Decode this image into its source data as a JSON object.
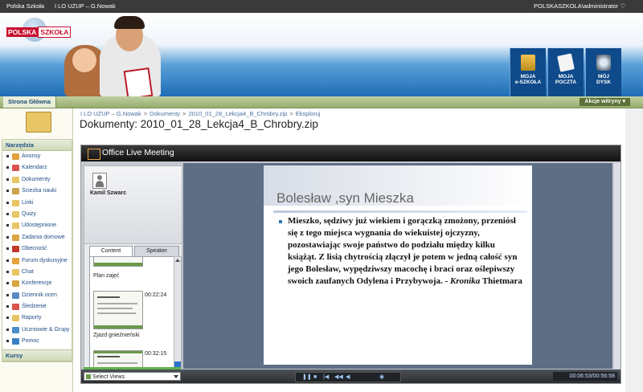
{
  "topbar": {
    "site": "Polska Szkoła",
    "user_path": "I LO UZUP – G.Nowak",
    "login": "POLSKASZKOLA\\administrator ♡"
  },
  "header": {
    "logo_part1": "POLSKA",
    "logo_part2": "SZKOŁA",
    "buttons": [
      {
        "line1": "MOJA",
        "line2": "e-SZKOŁA",
        "icon": "book-icon"
      },
      {
        "line1": "MOJA",
        "line2": "POCZTA",
        "icon": "mail-icon"
      },
      {
        "line1": "MÓJ",
        "line2": "DYSK",
        "icon": "disk-icon"
      }
    ]
  },
  "nav": {
    "home_tab": "Strona Główna",
    "actions": "Akcje witryny ▾"
  },
  "sidebar": {
    "tools_header": "Narzędzia",
    "items": [
      "Anonsy",
      "Kalendarz",
      "Dokumenty",
      "Ścieżka nauki",
      "Linki",
      "Quizy",
      "Udostępnione",
      "Zadania domowe",
      "Obecność",
      "Forum dyskusyjne",
      "Chat",
      "Konferencje",
      "Dziennik ocen",
      "Śledzenie",
      "Raporty",
      "Uczniowie & Grupy",
      "Pomoc"
    ],
    "courses_header": "Kursy"
  },
  "breadcrumb": [
    "I LO UZUP – G.Nowak",
    "Dokumenty",
    "2010_01_28_Lekcja4_B_Chrobry.zip",
    "Eksploruj"
  ],
  "page_title": "Dokumenty: 2010_01_28_Lekcja4_B_Chrobry.zip",
  "meeting": {
    "app_title": "Office Live Meeting",
    "speaker_name": "Kamil Szwarc",
    "tabs": [
      "Content",
      "Speaker"
    ],
    "slides": [
      {
        "label": "Plan zajęć",
        "time": ""
      },
      {
        "label": "Zjazd gnieźnieński",
        "time": "00:22:24"
      },
      {
        "label": "",
        "time": "00:32:15"
      }
    ],
    "slide_title": "Bolesław ,syn Mieszka",
    "slide_body_part1": "Mieszko, sędziwy już wiekiem i gorączką zmożony, przeniósł się z tego miejsca wygnania do wiekuistej ojczyzny, pozostawiając swoje państwo do podziału między kilku książąt. Z lisią chytrością złączył je potem w jedną całość syn jego Bolesław, wypędziwszy macochę i braci oraz oślepiwszy swoich zaufanych Odylena i Przybywoja. -",
    "slide_body_source": "Kronika",
    "slide_body_part2": " Thietmara",
    "select_views": "Select Views",
    "timecode": "00:06:53/00:56:58",
    "control_icons": [
      "pause-icon",
      "stop-icon",
      "prev-icon",
      "rewind-icon",
      "volume-icon",
      "forward-icon"
    ]
  },
  "colors": {
    "accent_blue": "#1f6db6",
    "nav_green": "#97ad6e",
    "actions_bg": "#5c7036",
    "brand_red": "#c8102e",
    "link": "#1f4f86"
  }
}
